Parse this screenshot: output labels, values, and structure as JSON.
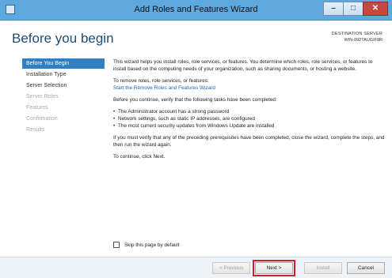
{
  "window": {
    "title": "Add Roles and Features Wizard",
    "buttons": {
      "minimize": "–",
      "maximize": "□",
      "close": "✕"
    }
  },
  "header": {
    "title": "Before you begin",
    "destination_label": "DESTINATION SERVER",
    "destination_server": "WIN-092TAUGIF8R"
  },
  "nav": {
    "items": [
      {
        "label": "Before You Begin",
        "state": "active"
      },
      {
        "label": "Installation Type",
        "state": "enabled"
      },
      {
        "label": "Server Selection",
        "state": "enabled"
      },
      {
        "label": "Server Roles",
        "state": "disabled"
      },
      {
        "label": "Features",
        "state": "disabled"
      },
      {
        "label": "Confirmation",
        "state": "disabled"
      },
      {
        "label": "Results",
        "state": "disabled"
      }
    ]
  },
  "content": {
    "intro": "This wizard helps you install roles, role services, or features. You determine which roles, role services, or features to install based on the computing needs of your organization, such as sharing documents, or hosting a website.",
    "remove_prompt": "To remove roles, role services, or features:",
    "remove_link": "Start the Remove Roles and Features Wizard",
    "verify_intro": "Before you continue, verify that the following tasks have been completed:",
    "bullets": [
      "The Administrator account has a strong password",
      "Network settings, such as static IP addresses, are configured",
      "The most current security updates from Windows Update are installed"
    ],
    "prereq_note": "If you must verify that any of the preceding prerequisites have been completed, close the wizard, complete the steps, and then run the wizard again.",
    "continue_note": "To continue, click Next."
  },
  "skip": {
    "label": "Skip this page by default",
    "checked": false
  },
  "footer": {
    "previous": "< Previous",
    "next": "Next >",
    "install": "Install",
    "cancel": "Cancel"
  },
  "colors": {
    "titlebar": "#5ea8e0",
    "nav_active": "#2f7fc4",
    "link": "#1565b8",
    "highlight": "#d9182d"
  }
}
